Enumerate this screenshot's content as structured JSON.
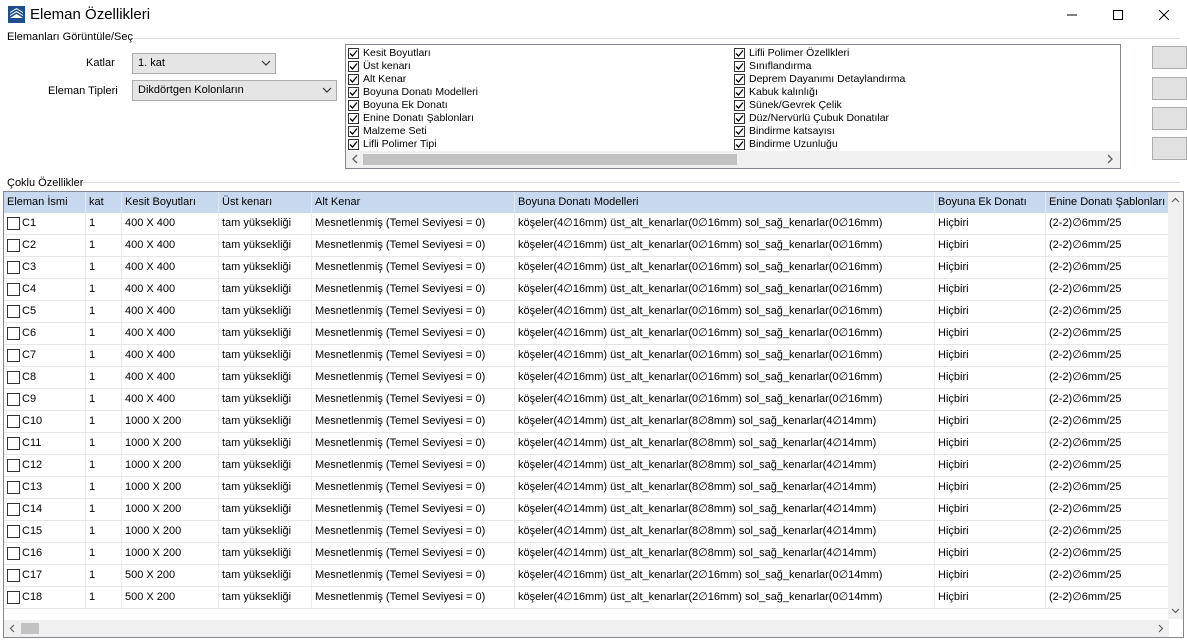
{
  "window": {
    "title": "Eleman Özellikleri",
    "icon": "stacked-layers-icon",
    "controls": [
      "minimize-icon",
      "maximize-icon",
      "close-icon"
    ]
  },
  "filter_group": {
    "label": "Elemanları Görüntüle/Seç",
    "katlar_label": "Katlar",
    "katlar_value": "1. kat",
    "tipler_label": "Eleman Tipleri",
    "tipler_value": "Dikdörtgen Kolonların"
  },
  "properties_left": [
    {
      "label": "Kesit Boyutları",
      "checked": true
    },
    {
      "label": "Üst kenarı",
      "checked": true
    },
    {
      "label": "Alt Kenar",
      "checked": true
    },
    {
      "label": "Boyuna Donatı Modelleri",
      "checked": true
    },
    {
      "label": "Boyuna Ek Donatı",
      "checked": true
    },
    {
      "label": "Enine Donatı Şablonları",
      "checked": true
    },
    {
      "label": "Malzeme Seti",
      "checked": true
    },
    {
      "label": "Lifli Polimer Tipi",
      "checked": true
    }
  ],
  "properties_right": [
    {
      "label": "Lifli Polimer Özellkleri",
      "checked": true
    },
    {
      "label": "Sınıflandırma",
      "checked": true
    },
    {
      "label": "Deprem Dayanımı Detaylandırma",
      "checked": true
    },
    {
      "label": "Kabuk kalınlığı",
      "checked": true
    },
    {
      "label": "Sünek/Gevrek Çelik",
      "checked": true
    },
    {
      "label": "Düz/Nervürlü Çubuk Donatılar",
      "checked": true
    },
    {
      "label": "Bindirme katsayısı",
      "checked": true
    },
    {
      "label": "Bindirme Uzunluğu",
      "checked": true
    }
  ],
  "table": {
    "group_label": "Çoklu Özellikler",
    "columns": [
      "Eleman İsmi",
      "kat",
      "Kesit Boyutları",
      "Üst kenarı",
      "Alt Kenar",
      "Boyuna Donatı Modelleri",
      "Boyuna Ek Donatı",
      "Enine Donatı Şablonları"
    ],
    "rows": [
      [
        "C1",
        "1",
        "400 X 400",
        "tam yüksekliği",
        "Mesnetlenmiş (Temel Seviyesi = 0)",
        "köşeler(4∅16mm)  üst_alt_kenarlar(0∅16mm)  sol_sağ_kenarlar(0∅16mm)",
        "Hiçbiri",
        "(2-2)∅6mm/25"
      ],
      [
        "C2",
        "1",
        "400 X 400",
        "tam yüksekliği",
        "Mesnetlenmiş (Temel Seviyesi = 0)",
        "köşeler(4∅16mm)  üst_alt_kenarlar(0∅16mm)  sol_sağ_kenarlar(0∅16mm)",
        "Hiçbiri",
        "(2-2)∅6mm/25"
      ],
      [
        "C3",
        "1",
        "400 X 400",
        "tam yüksekliği",
        "Mesnetlenmiş (Temel Seviyesi = 0)",
        "köşeler(4∅16mm)  üst_alt_kenarlar(0∅16mm)  sol_sağ_kenarlar(0∅16mm)",
        "Hiçbiri",
        "(2-2)∅6mm/25"
      ],
      [
        "C4",
        "1",
        "400 X 400",
        "tam yüksekliği",
        "Mesnetlenmiş (Temel Seviyesi = 0)",
        "köşeler(4∅16mm)  üst_alt_kenarlar(0∅16mm)  sol_sağ_kenarlar(0∅16mm)",
        "Hiçbiri",
        "(2-2)∅6mm/25"
      ],
      [
        "C5",
        "1",
        "400 X 400",
        "tam yüksekliği",
        "Mesnetlenmiş (Temel Seviyesi = 0)",
        "köşeler(4∅16mm)  üst_alt_kenarlar(0∅16mm)  sol_sağ_kenarlar(0∅16mm)",
        "Hiçbiri",
        "(2-2)∅6mm/25"
      ],
      [
        "C6",
        "1",
        "400 X 400",
        "tam yüksekliği",
        "Mesnetlenmiş (Temel Seviyesi = 0)",
        "köşeler(4∅16mm)  üst_alt_kenarlar(0∅16mm)  sol_sağ_kenarlar(0∅16mm)",
        "Hiçbiri",
        "(2-2)∅6mm/25"
      ],
      [
        "C7",
        "1",
        "400 X 400",
        "tam yüksekliği",
        "Mesnetlenmiş (Temel Seviyesi = 0)",
        "köşeler(4∅16mm)  üst_alt_kenarlar(0∅16mm)  sol_sağ_kenarlar(0∅16mm)",
        "Hiçbiri",
        "(2-2)∅6mm/25"
      ],
      [
        "C8",
        "1",
        "400 X 400",
        "tam yüksekliği",
        "Mesnetlenmiş (Temel Seviyesi = 0)",
        "köşeler(4∅16mm)  üst_alt_kenarlar(0∅16mm)  sol_sağ_kenarlar(0∅16mm)",
        "Hiçbiri",
        "(2-2)∅6mm/25"
      ],
      [
        "C9",
        "1",
        "400 X 400",
        "tam yüksekliği",
        "Mesnetlenmiş (Temel Seviyesi = 0)",
        "köşeler(4∅16mm)  üst_alt_kenarlar(0∅16mm)  sol_sağ_kenarlar(0∅16mm)",
        "Hiçbiri",
        "(2-2)∅6mm/25"
      ],
      [
        "C10",
        "1",
        "1000 X 200",
        "tam yüksekliği",
        "Mesnetlenmiş (Temel Seviyesi = 0)",
        "köşeler(4∅14mm)  üst_alt_kenarlar(8∅8mm)  sol_sağ_kenarlar(4∅14mm)",
        "Hiçbiri",
        "(2-2)∅6mm/25"
      ],
      [
        "C11",
        "1",
        "1000 X 200",
        "tam yüksekliği",
        "Mesnetlenmiş (Temel Seviyesi = 0)",
        "köşeler(4∅14mm)  üst_alt_kenarlar(8∅8mm)  sol_sağ_kenarlar(4∅14mm)",
        "Hiçbiri",
        "(2-2)∅6mm/25"
      ],
      [
        "C12",
        "1",
        "1000 X 200",
        "tam yüksekliği",
        "Mesnetlenmiş (Temel Seviyesi = 0)",
        "köşeler(4∅14mm)  üst_alt_kenarlar(8∅8mm)  sol_sağ_kenarlar(4∅14mm)",
        "Hiçbiri",
        "(2-2)∅6mm/25"
      ],
      [
        "C13",
        "1",
        "1000 X 200",
        "tam yüksekliği",
        "Mesnetlenmiş (Temel Seviyesi = 0)",
        "köşeler(4∅14mm)  üst_alt_kenarlar(8∅8mm)  sol_sağ_kenarlar(4∅14mm)",
        "Hiçbiri",
        "(2-2)∅6mm/25"
      ],
      [
        "C14",
        "1",
        "1000 X 200",
        "tam yüksekliği",
        "Mesnetlenmiş (Temel Seviyesi = 0)",
        "köşeler(4∅14mm)  üst_alt_kenarlar(8∅8mm)  sol_sağ_kenarlar(4∅14mm)",
        "Hiçbiri",
        "(2-2)∅6mm/25"
      ],
      [
        "C15",
        "1",
        "1000 X 200",
        "tam yüksekliği",
        "Mesnetlenmiş (Temel Seviyesi = 0)",
        "köşeler(4∅14mm)  üst_alt_kenarlar(8∅8mm)  sol_sağ_kenarlar(4∅14mm)",
        "Hiçbiri",
        "(2-2)∅6mm/25"
      ],
      [
        "C16",
        "1",
        "1000 X 200",
        "tam yüksekliği",
        "Mesnetlenmiş (Temel Seviyesi = 0)",
        "köşeler(4∅14mm)  üst_alt_kenarlar(8∅8mm)  sol_sağ_kenarlar(4∅14mm)",
        "Hiçbiri",
        "(2-2)∅6mm/25"
      ],
      [
        "C17",
        "1",
        "500 X 200",
        "tam yüksekliği",
        "Mesnetlenmiş (Temel Seviyesi = 0)",
        "köşeler(4∅16mm)  üst_alt_kenarlar(2∅16mm)  sol_sağ_kenarlar(0∅14mm)",
        "Hiçbiri",
        "(2-2)∅6mm/25"
      ],
      [
        "C18",
        "1",
        "500 X 200",
        "tam yüksekliği",
        "Mesnetlenmiş (Temel Seviyesi = 0)",
        "köşeler(4∅16mm)  üst_alt_kenarlar(2∅16mm)  sol_sağ_kenarlar(0∅14mm)",
        "Hiçbiri",
        "(2-2)∅6mm/25"
      ]
    ]
  },
  "colors": {
    "header_bg": "#c8d9ef",
    "scroll_thumb": "#c2c2c2"
  }
}
